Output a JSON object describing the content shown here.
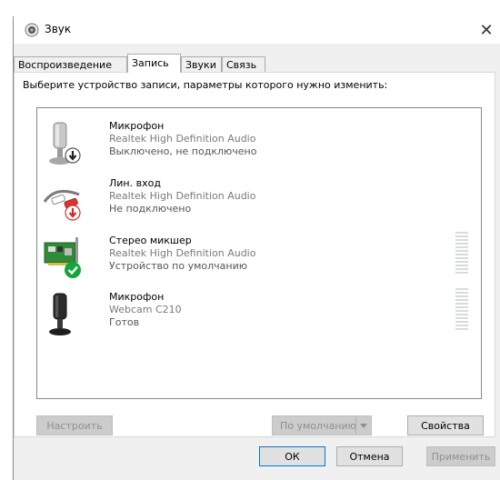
{
  "window": {
    "title": "Звук",
    "close_glyph": "✕"
  },
  "tabs": [
    {
      "label": "Воспроизведение"
    },
    {
      "label": "Запись"
    },
    {
      "label": "Звуки"
    },
    {
      "label": "Связь"
    }
  ],
  "instruction": "Выберите устройство записи, параметры которого нужно изменить:",
  "devices": [
    {
      "name": "Микрофон",
      "driver": "Realtek High Definition Audio",
      "status": "Выключено, не подключено",
      "icon": "microphone-icon",
      "badge": "arrow-down-badge"
    },
    {
      "name": "Лин. вход",
      "driver": "Realtek High Definition Audio",
      "status": "Не подключено",
      "icon": "line-in-cable-icon",
      "badge": "red-arrow-down-badge"
    },
    {
      "name": "Стерео микшер",
      "driver": "Realtek High Definition Audio",
      "status": "Устройство по умолчанию",
      "icon": "sound-card-icon",
      "badge": "green-check-badge"
    },
    {
      "name": "Микрофон",
      "driver": "Webcam C210",
      "status": "Готов",
      "icon": "webcam-microphone-icon"
    }
  ],
  "buttons": {
    "configure": "Настроить",
    "set_default": "По умолчанию",
    "properties": "Свойства",
    "ok": "ОК",
    "cancel": "Отмена",
    "apply": "Применить"
  },
  "colors": {
    "accent": "#0078d7",
    "default_check": "#16a53a",
    "disconnected_arrow": "#d9261c"
  }
}
